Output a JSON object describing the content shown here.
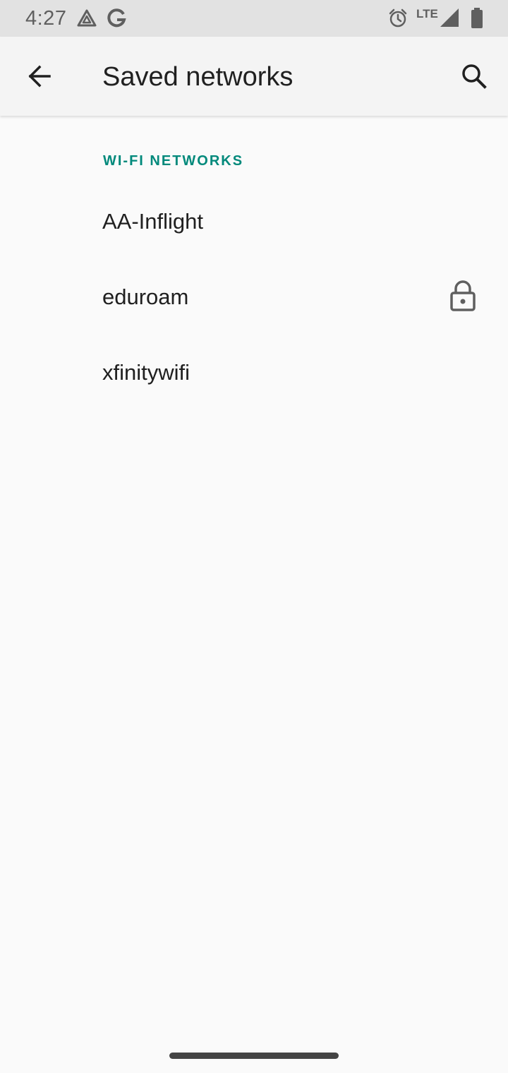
{
  "status_bar": {
    "time": "4:27",
    "network_type": "LTE",
    "battery_level": "98",
    "icons": [
      "drive-notification-icon",
      "google-notification-icon",
      "alarm-icon",
      "cell-signal-icon",
      "battery-icon"
    ]
  },
  "app_bar": {
    "title": "Saved networks",
    "back_icon": "arrow-back-icon",
    "search_icon": "search-icon"
  },
  "section": {
    "header": "WI-FI NETWORKS",
    "networks": [
      {
        "name": "AA-Inflight",
        "secured": false
      },
      {
        "name": "eduroam",
        "secured": true
      },
      {
        "name": "xfinitywifi",
        "secured": false
      }
    ]
  },
  "colors": {
    "accent": "#00897b",
    "background": "#fafafa",
    "status_bar": "#e2e2e2",
    "app_bar": "#f4f4f4",
    "text_primary": "#202020",
    "icon_gray": "#5f5f5f"
  }
}
